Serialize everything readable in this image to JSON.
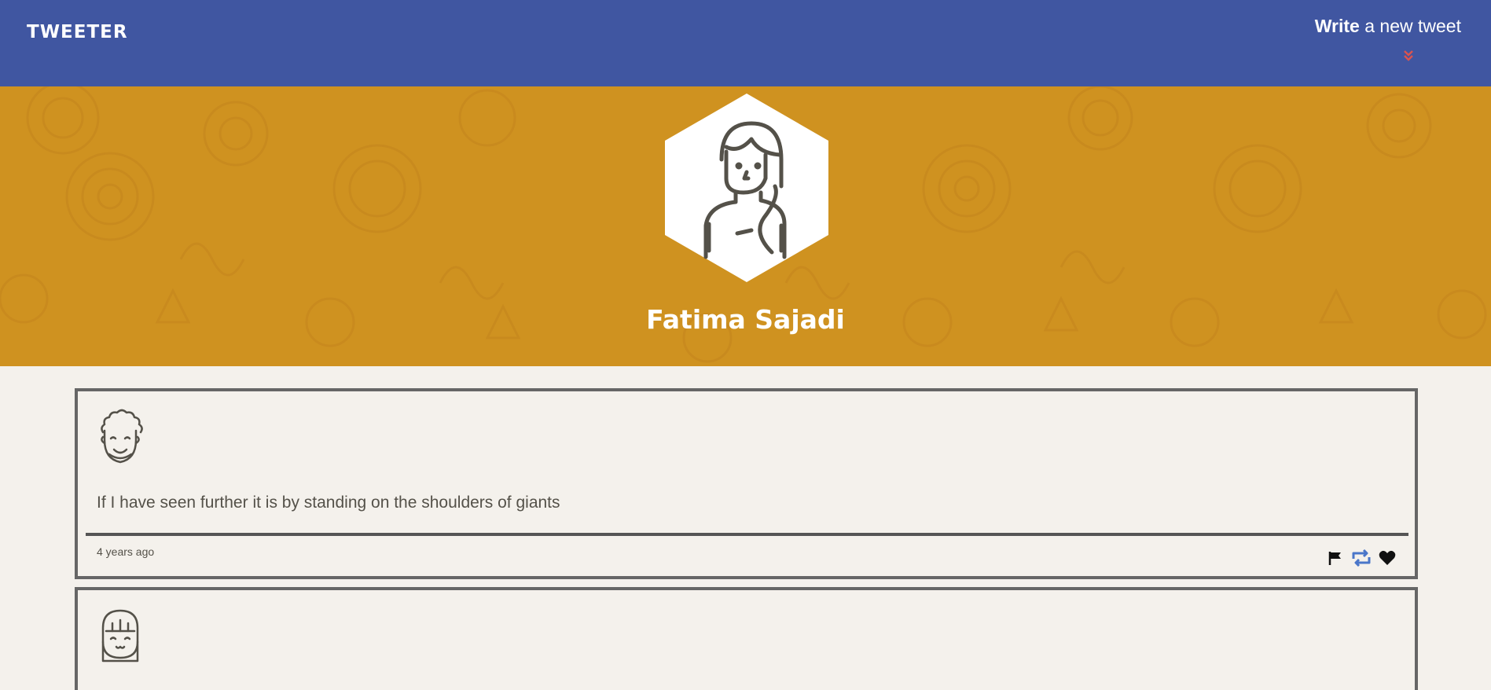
{
  "nav": {
    "brand": "TWEETER",
    "compose_bold": "Write",
    "compose_rest": " a new tweet"
  },
  "profile": {
    "name": "Fatima Sajadi"
  },
  "tweets": [
    {
      "text": "If I have seen further it is by standing on the shoulders of giants",
      "time": "4 years ago",
      "avatar_icon": "curly-hair-face-icon"
    },
    {
      "text": "",
      "time": "",
      "avatar_icon": "bangs-hair-face-icon"
    }
  ],
  "colors": {
    "nav_bg": "#4056a1",
    "header_bg": "#cf9220",
    "page_bg": "#f4f1ec",
    "accent_red": "#d9534f",
    "retweet_blue": "#4a76c9"
  }
}
